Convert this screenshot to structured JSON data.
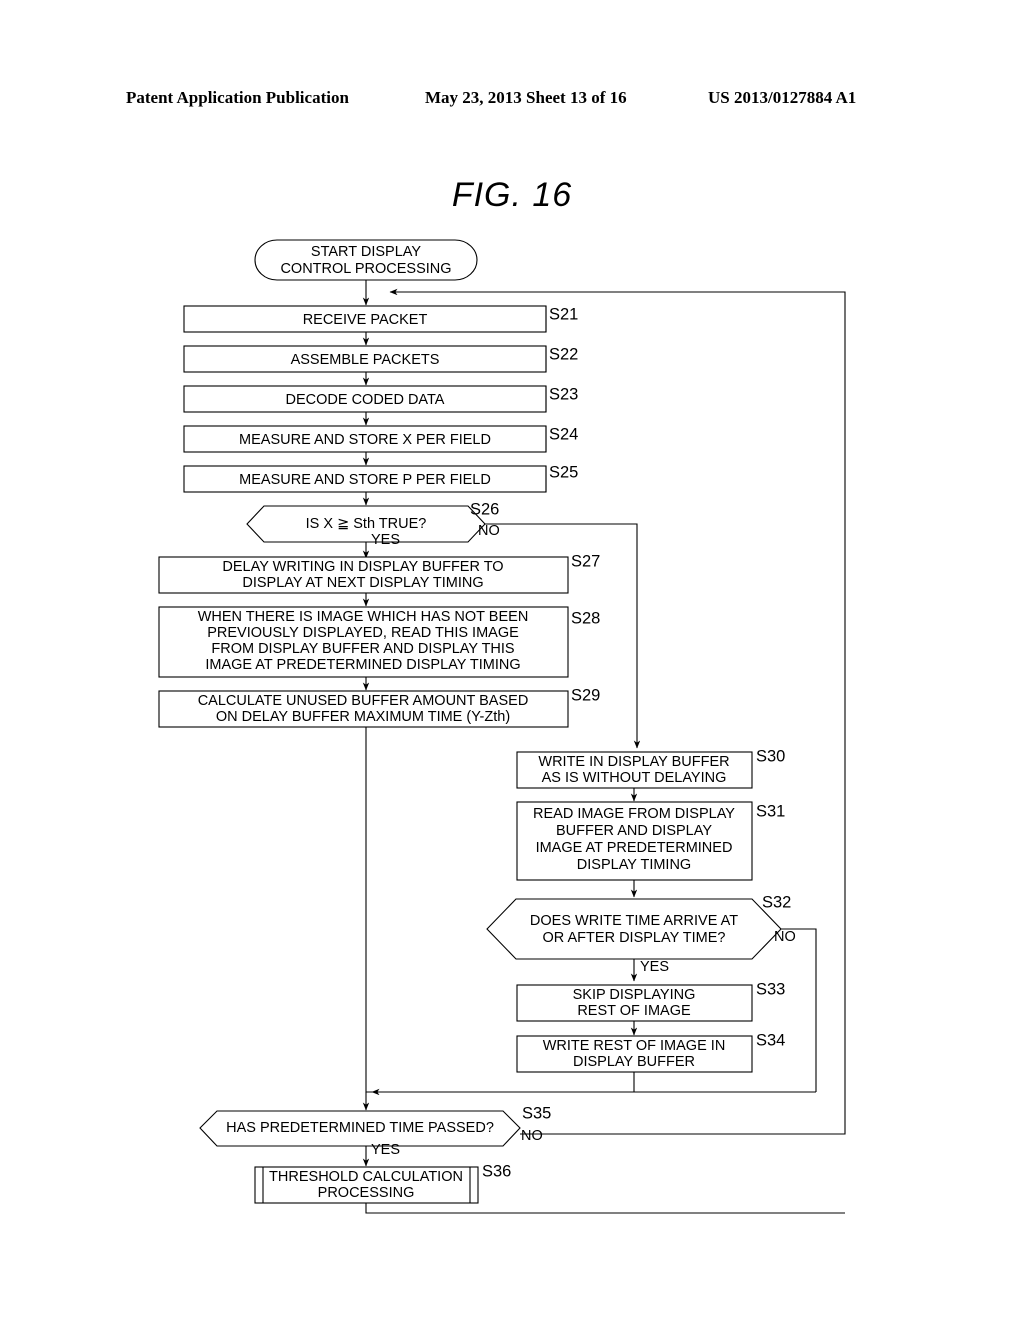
{
  "header": {
    "publication": "Patent Application Publication",
    "date_sheet": "May 23, 2013  Sheet 13 of 16",
    "patent_number": "US 2013/0127884 A1"
  },
  "figure": {
    "title": "FIG. 16",
    "type": "flowchart",
    "terminator": {
      "line1": "START DISPLAY",
      "line2": "CONTROL PROCESSING"
    },
    "steps": [
      {
        "id": "S21",
        "shape": "process",
        "lines": [
          "RECEIVE PACKET"
        ]
      },
      {
        "id": "S22",
        "shape": "process",
        "lines": [
          "ASSEMBLE PACKETS"
        ]
      },
      {
        "id": "S23",
        "shape": "process",
        "lines": [
          "DECODE CODED DATA"
        ]
      },
      {
        "id": "S24",
        "shape": "process",
        "lines": [
          "MEASURE AND STORE X PER FIELD"
        ]
      },
      {
        "id": "S25",
        "shape": "process",
        "lines": [
          "MEASURE AND STORE P PER FIELD"
        ]
      },
      {
        "id": "S26",
        "shape": "decision",
        "lines": [
          "IS X ≧ Sth TRUE?"
        ],
        "yes": "YES",
        "no": "NO"
      },
      {
        "id": "S27",
        "shape": "process",
        "lines": [
          "DELAY WRITING IN DISPLAY BUFFER TO",
          "DISPLAY AT NEXT DISPLAY TIMING"
        ]
      },
      {
        "id": "S28",
        "shape": "process",
        "lines": [
          "WHEN THERE IS IMAGE WHICH HAS NOT BEEN",
          "PREVIOUSLY DISPLAYED, READ THIS IMAGE",
          "FROM DISPLAY BUFFER AND DISPLAY THIS",
          "IMAGE AT PREDETERMINED DISPLAY TIMING"
        ]
      },
      {
        "id": "S29",
        "shape": "process",
        "lines": [
          "CALCULATE UNUSED BUFFER AMOUNT BASED",
          "ON DELAY BUFFER MAXIMUM TIME (Y-Zth)"
        ]
      },
      {
        "id": "S30",
        "shape": "process",
        "lines": [
          "WRITE IN DISPLAY BUFFER",
          "AS IS WITHOUT DELAYING"
        ]
      },
      {
        "id": "S31",
        "shape": "process",
        "lines": [
          "READ IMAGE FROM DISPLAY",
          "BUFFER AND DISPLAY",
          "IMAGE AT PREDETERMINED",
          "DISPLAY TIMING"
        ]
      },
      {
        "id": "S32",
        "shape": "decision",
        "lines": [
          "DOES WRITE TIME ARRIVE AT",
          "OR AFTER DISPLAY TIME?"
        ],
        "yes": "YES",
        "no": "NO"
      },
      {
        "id": "S33",
        "shape": "process",
        "lines": [
          "SKIP DISPLAYING",
          "REST OF IMAGE"
        ]
      },
      {
        "id": "S34",
        "shape": "process",
        "lines": [
          "WRITE REST OF IMAGE IN",
          "DISPLAY BUFFER"
        ]
      },
      {
        "id": "S35",
        "shape": "decision",
        "lines": [
          "HAS PREDETERMINED TIME PASSED?"
        ],
        "yes": "YES",
        "no": "NO"
      },
      {
        "id": "S36",
        "shape": "predefined-process",
        "lines": [
          "THRESHOLD CALCULATION",
          "PROCESSING"
        ]
      }
    ]
  }
}
